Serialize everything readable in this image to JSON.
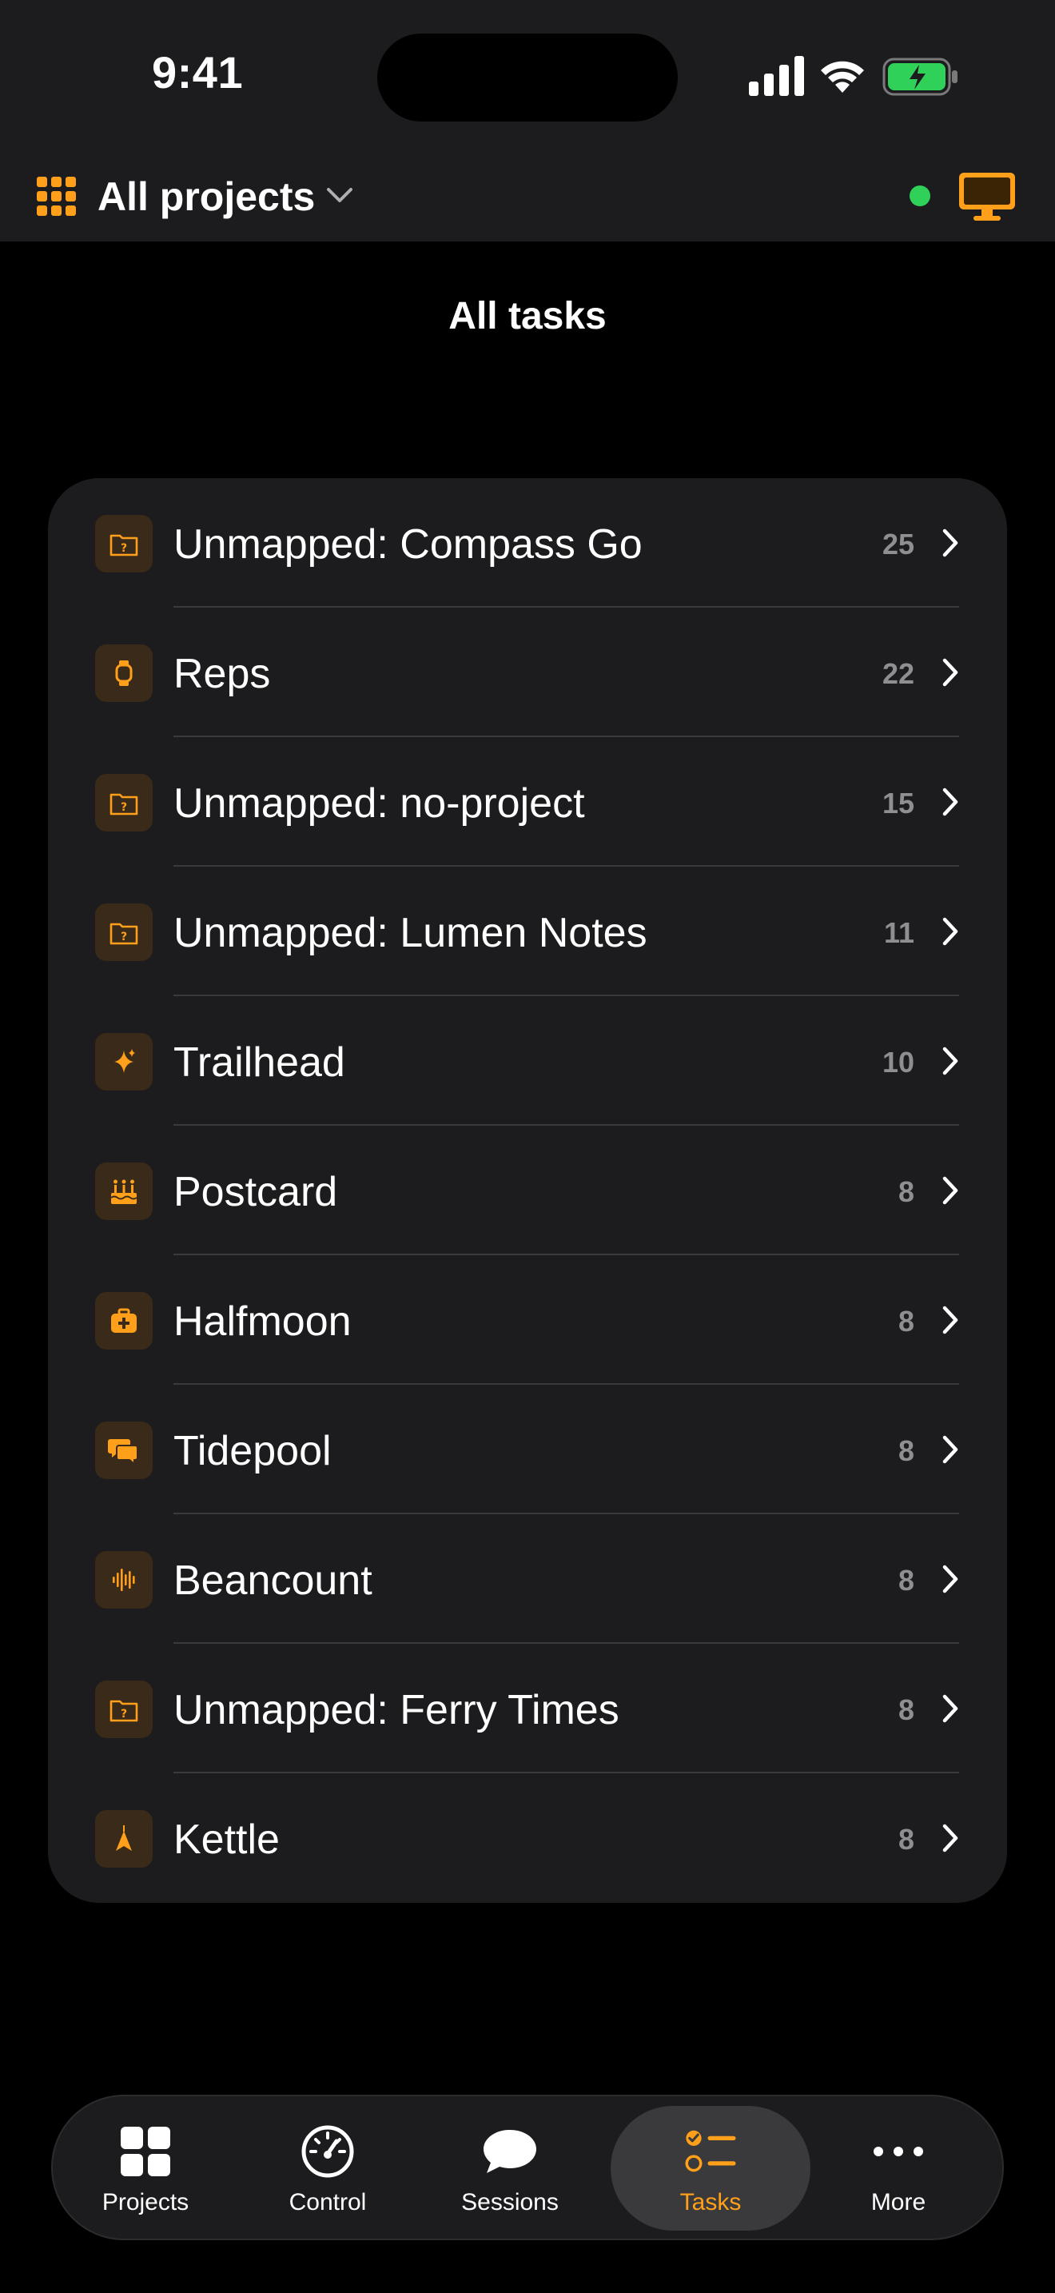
{
  "status_bar": {
    "time": "9:41"
  },
  "header": {
    "title": "All projects",
    "connection_status": "connected",
    "accent_color": "#ff9f1a"
  },
  "page": {
    "title": "All tasks"
  },
  "projects": [
    {
      "label": "Unmapped: Compass Go",
      "count": "25",
      "icon": "question-folder-icon"
    },
    {
      "label": "Reps",
      "count": "22",
      "icon": "watch-icon"
    },
    {
      "label": "Unmapped: no-project",
      "count": "15",
      "icon": "question-folder-icon"
    },
    {
      "label": "Unmapped: Lumen Notes",
      "count": "11",
      "icon": "question-folder-icon"
    },
    {
      "label": "Trailhead",
      "count": "10",
      "icon": "sparkle-icon"
    },
    {
      "label": "Postcard",
      "count": "8",
      "icon": "cake-icon"
    },
    {
      "label": "Halfmoon",
      "count": "8",
      "icon": "medical-bag-icon"
    },
    {
      "label": "Tidepool",
      "count": "8",
      "icon": "chat-bubbles-icon"
    },
    {
      "label": "Beancount",
      "count": "8",
      "icon": "waveform-icon"
    },
    {
      "label": "Unmapped: Ferry Times",
      "count": "8",
      "icon": "question-folder-icon"
    },
    {
      "label": "Kettle",
      "count": "8",
      "icon": "cone-icon"
    }
  ],
  "tab_bar": {
    "tabs": [
      {
        "label": "Projects",
        "icon": "grid-icon"
      },
      {
        "label": "Control",
        "icon": "gauge-icon"
      },
      {
        "label": "Sessions",
        "icon": "chat-bubble-icon"
      },
      {
        "label": "Tasks",
        "icon": "checklist-icon",
        "active": true
      },
      {
        "label": "More",
        "icon": "ellipsis-icon"
      }
    ]
  }
}
